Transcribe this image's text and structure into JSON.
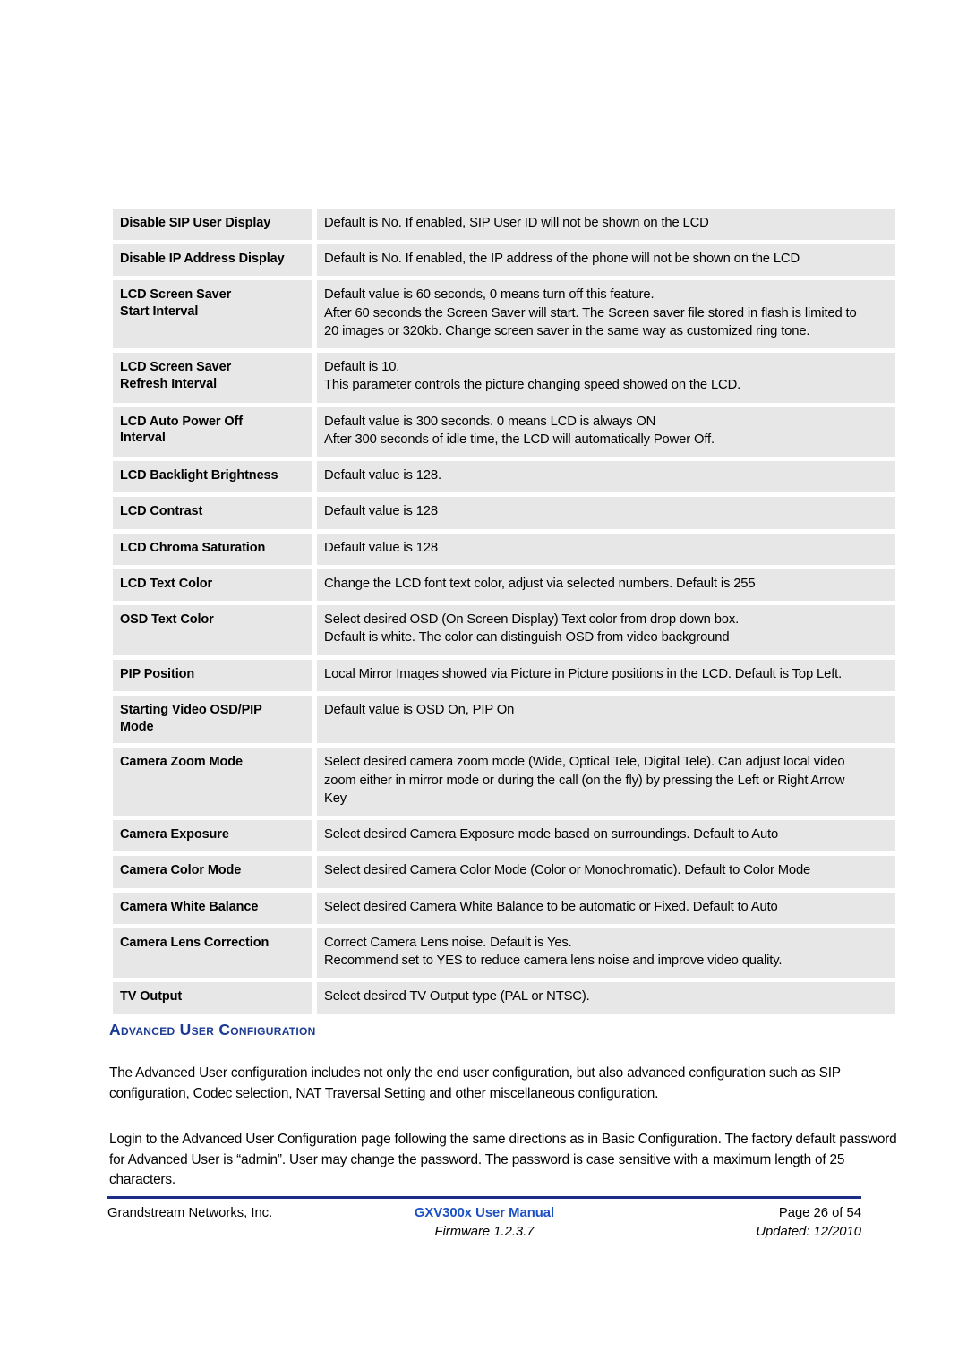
{
  "document": {
    "page_label": "Page 26 of 54"
  },
  "settings_table": {
    "rows": [
      {
        "name": "Disable SIP User Display",
        "lines": [
          "Default is No. If enabled, SIP User ID will not be shown on the LCD"
        ]
      },
      {
        "name": "Disable IP Address Display",
        "lines": [
          "Default is No. If enabled, the IP address of the phone will not be shown on the LCD"
        ]
      },
      {
        "name": "LCD Screen Saver\nStart Interval",
        "lines": [
          "Default value is 60 seconds, 0 means turn off this feature.",
          "After 60 seconds the Screen Saver will start. The Screen saver file stored in flash is limited to",
          "20 images or 320kb.  Change screen saver in the same way as customized ring tone."
        ]
      },
      {
        "name": "LCD Screen Saver\nRefresh Interval",
        "lines": [
          "Default is 10.",
          "This parameter controls the picture changing speed showed on the LCD."
        ]
      },
      {
        "name": "LCD Auto Power Off\nInterval",
        "lines": [
          "Default value is 300 seconds. 0 means LCD is always ON",
          "After 300 seconds of idle time, the LCD will automatically Power Off."
        ]
      },
      {
        "name": "LCD Backlight Brightness",
        "lines": [
          "Default value is 128."
        ]
      },
      {
        "name": "LCD Contrast",
        "lines": [
          "Default value is 128"
        ]
      },
      {
        "name": "LCD Chroma Saturation",
        "lines": [
          "Default value is 128"
        ]
      },
      {
        "name": "LCD Text Color",
        "lines": [
          "Change the LCD font text color, adjust via selected numbers. Default is 255"
        ]
      },
      {
        "name": "OSD Text Color",
        "lines": [
          "Select desired OSD (On Screen Display) Text color from drop down box.",
          "Default is white. The color can distinguish OSD from video background"
        ]
      },
      {
        "name": "PIP Position",
        "lines": [
          "Local Mirror Images showed via Picture in Picture positions in the LCD. Default is Top Left."
        ]
      },
      {
        "name": "Starting Video OSD/PIP\nMode",
        "lines": [
          "Default value is OSD On, PIP On"
        ]
      },
      {
        "name": "Camera Zoom Mode",
        "lines": [
          "Select desired camera zoom mode (Wide, Optical Tele, Digital Tele). Can adjust local video",
          "zoom either in mirror mode or during the call (on the fly) by pressing the Left or Right Arrow",
          "Key"
        ]
      },
      {
        "name": "Camera Exposure",
        "lines": [
          "Select desired Camera Exposure mode based on surroundings. Default to Auto"
        ]
      },
      {
        "name": "Camera Color Mode",
        "lines": [
          "Select desired Camera Color Mode (Color or Monochromatic). Default to Color Mode"
        ]
      },
      {
        "name": "Camera White Balance",
        "lines": [
          "Select desired Camera White Balance to be automatic or Fixed. Default to Auto"
        ]
      },
      {
        "name": "Camera Lens Correction",
        "lines": [
          "Correct Camera Lens noise. Default is Yes.",
          "Recommend set to YES to reduce camera lens noise and improve video quality."
        ]
      },
      {
        "name": "TV Output",
        "lines": [
          "Select desired TV Output type (PAL or NTSC)."
        ]
      }
    ]
  },
  "section": {
    "heading": "Advanced User Configuration",
    "paragraph_1": "The Advanced User configuration includes not only the end user configuration, but also advanced configuration such as SIP configuration, Codec selection, NAT Traversal Setting and other miscellaneous configuration.",
    "paragraph_2": "Login to the Advanced User Configuration page following the same directions as in Basic Configuration. The factory default password for Advanced User is “admin”.  User may change the password.  The password is case sensitive with a maximum length of 25 characters."
  },
  "footer": {
    "company": "Grandstream Networks, Inc.",
    "manual_title": "GXV300x User Manual",
    "firmware": "Firmware 1.2.3.7",
    "page": "Page 26 of 54",
    "updated": "Updated: 12/2010"
  },
  "colors": {
    "heading_blue": "#1b3a94",
    "footer_title_blue": "#1c50c4",
    "footer_rule_navy": "#1b2d86",
    "cell_gray": "#e7e7e7"
  }
}
